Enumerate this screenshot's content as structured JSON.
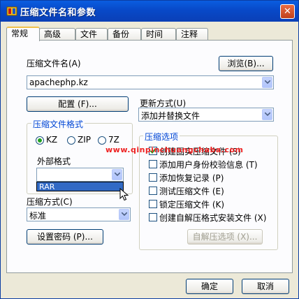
{
  "window": {
    "title": "压缩文件名和参数",
    "close_glyph": "✕"
  },
  "tabs": [
    {
      "label": "常规"
    },
    {
      "label": "高级"
    },
    {
      "label": "文件"
    },
    {
      "label": "备份"
    },
    {
      "label": "时间"
    },
    {
      "label": "注释"
    }
  ],
  "archive": {
    "name_label": "压缩文件名(A)",
    "name_value": "apachephp.kz",
    "browse_label": "浏览(B)..."
  },
  "config_label": "配置 (F)...",
  "update": {
    "label": "更新方式(U)",
    "value": "添加并替换文件"
  },
  "format_group": {
    "title": "压缩文件格式",
    "options": [
      {
        "label": "KZ",
        "selected": true
      },
      {
        "label": "ZIP",
        "selected": false
      },
      {
        "label": "7Z",
        "selected": false
      }
    ],
    "external_label": "外部格式",
    "external_value": "",
    "dropdown_item": "RAR"
  },
  "method": {
    "label": "压缩方式(C)",
    "value": "标准"
  },
  "password_label": "设置密码 (P)...",
  "options_group": {
    "title": "压缩选项",
    "items": [
      {
        "label": "创建固实压缩文件 (S)",
        "checked": true
      },
      {
        "label": "添加用户身份校验信息 (T)",
        "checked": false
      },
      {
        "label": "添加恢复记录 (P)",
        "checked": false
      },
      {
        "label": "测试压缩文件 (E)",
        "checked": false
      },
      {
        "label": "锁定压缩文件 (K)",
        "checked": false
      },
      {
        "label": "创建自解压格式安装文件 (X)",
        "checked": false
      }
    ],
    "sfx_label": "自解压选项 (X)..."
  },
  "watermark": "www.qinpinchuangchaba.com",
  "footer": {
    "ok_label": "确定",
    "cancel_label": "取消"
  }
}
